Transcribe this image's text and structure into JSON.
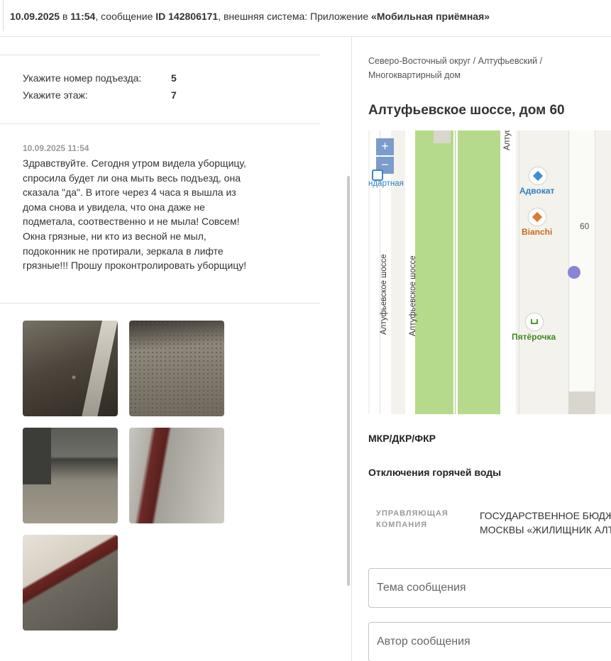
{
  "header": {
    "date": "10.09.2025",
    "in": " в ",
    "time": "11:54",
    "message_prefix": ", сообщение ",
    "id_label": "ID 142806171",
    "system_prefix": ", внешняя система: Приложение ",
    "system_name": "«Мобильная приёмная»"
  },
  "fields": [
    {
      "label": "Укажите номер подъезда:",
      "value": "5"
    },
    {
      "label": "Укажите этаж:",
      "value": "7"
    }
  ],
  "message": {
    "date": "10.09.2025 11:54",
    "text": "Здравствуйте. Сегодня утром видела уборщицу, спросила будет ли она мыть весь подъезд, она сказала \"да\". В итоге через 4 часа я вышла из дома снова и увидела, что она даже не подметала, соотвественно и не мыла! Совсем! Окна грязные, ни кто из весной не мыл, подоконник не протирали, зеркала в лифте грязные!!! Прошу проконтролировать уборщицу!"
  },
  "photos_count": 5,
  "location": {
    "breadcrumb": "Северо-Восточный округ / Алтуфьевский / Многоквартирный дом",
    "address": "Алтуфьевское шоссе, дом 60"
  },
  "map": {
    "zoom_in": "+",
    "zoom_out": "−",
    "street_left": "Алтуфьевское шоссе",
    "street_right": "Алтуфьевское шоссе",
    "street_top": "Алтуф",
    "partial_label": "ндартная",
    "poi": [
      {
        "label": "Адвокат",
        "color": "#3d8fd6"
      },
      {
        "label": "Bianchi",
        "color": "#e07a2f"
      },
      {
        "label": "Пятёрочка",
        "color": "#4a9a2a"
      }
    ],
    "house_number": "60",
    "marker_color": "#8a84d6",
    "green_color": "#b5da8b"
  },
  "sections": {
    "mkr": "МКР/ДКР/ФКР",
    "hot_water": "Отключения горячей воды"
  },
  "company": {
    "label": "УПРАВЛЯЮЩАЯ КОМПАНИЯ",
    "line1": "ГОСУДАРСТВЕННОЕ БЮДЖЕ",
    "line2": "МОСКВЫ «ЖИЛИЩНИК АЛТУ"
  },
  "form": {
    "subject_placeholder": "Тема сообщения",
    "author_placeholder": "Автор сообщения"
  }
}
